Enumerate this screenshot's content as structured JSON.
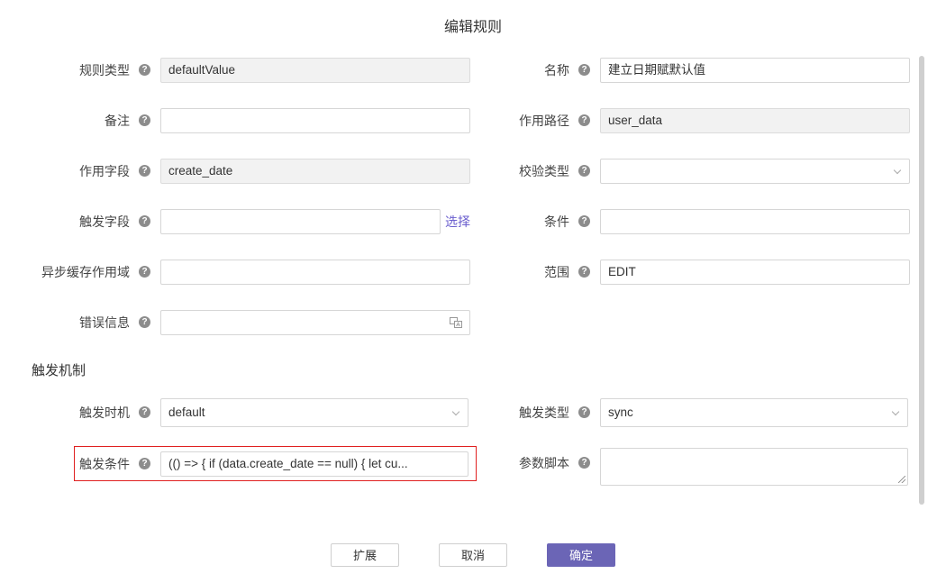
{
  "dialog": {
    "title": "编辑规则"
  },
  "left": {
    "rule_type": {
      "label": "规则类型",
      "value": "defaultValue"
    },
    "remark": {
      "label": "备注",
      "value": ""
    },
    "field": {
      "label": "作用字段",
      "value": "create_date"
    },
    "trigger_field": {
      "label": "触发字段",
      "value": "",
      "select_link": "选择"
    },
    "async_cache": {
      "label": "异步缓存作用域",
      "value": ""
    },
    "error_msg": {
      "label": "错误信息",
      "value": ""
    }
  },
  "right": {
    "name": {
      "label": "名称",
      "value": "建立日期赋默认值"
    },
    "path": {
      "label": "作用路径",
      "value": "user_data"
    },
    "check_type": {
      "label": "校验类型",
      "value": ""
    },
    "condition": {
      "label": "条件",
      "value": ""
    },
    "scope": {
      "label": "范围",
      "value": "EDIT"
    }
  },
  "trigger_section": {
    "heading": "触发机制",
    "timing": {
      "label": "触发时机",
      "value": "default"
    },
    "trigger_type": {
      "label": "触发类型",
      "value": "sync"
    },
    "trigger_condition": {
      "label": "触发条件",
      "value": "(() => {     if (data.create_date == null) {         let cu..."
    },
    "param_script": {
      "label": "参数脚本",
      "value": ""
    }
  },
  "footer": {
    "expand_label": "扩展",
    "cancel_label": "取消",
    "confirm_label": "确定"
  },
  "help_glyph": "?",
  "colors": {
    "primary": "#6b65b6",
    "link": "#6b5fce",
    "highlight": "#e02020"
  }
}
